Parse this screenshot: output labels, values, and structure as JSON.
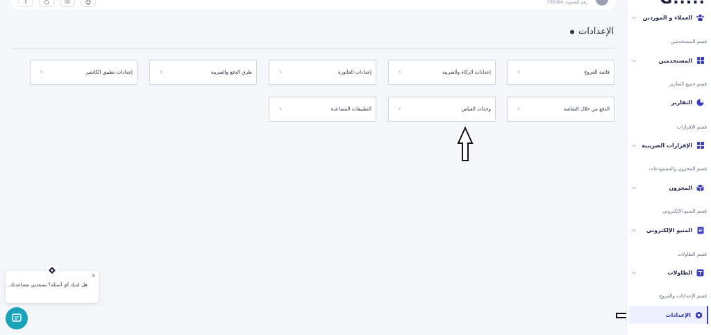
{
  "brand": "G.....",
  "topbar": {
    "registration_text": "رقم العضوية: 705064",
    "buttons": [
      "!",
      "⬡",
      "🗐",
      "☺"
    ]
  },
  "page": {
    "title": "الإعدادات"
  },
  "cards": [
    "قائمة الفروع",
    "إعدادات الزكاة والضريبة",
    "إعدادات الفاتورة",
    "طرق الدفع والضريبة",
    "إعدادات تطبيق الكاشير",
    "الدفع من خلال الشاشة",
    "وحدات القياس",
    "التطبيقات المساعدة"
  ],
  "sidebar": {
    "items": [
      {
        "label": "العملاء و الموردين",
        "icon": "users-icon"
      },
      {
        "section": "قسم المستخدمين",
        "label": "المستخدمين",
        "icon": "grid-icon"
      },
      {
        "section": "قسم جميع التقارير",
        "label": "التقارير",
        "icon": "pie-chart-icon"
      },
      {
        "section": "قسم الإقرارات",
        "label": "الإقرارات الضريبية",
        "icon": "grid-icon"
      },
      {
        "section": "قسم المخزون والمستودعات",
        "label": "المخزون",
        "icon": "box-icon"
      },
      {
        "section": "قسم المنيو الإلكتروني",
        "label": "المنيو الإلكتروني",
        "icon": "menu-doc-icon"
      },
      {
        "section": "قسم الطاولات",
        "label": "الطاولات",
        "icon": "table-icon"
      },
      {
        "section": "قسم الإعدادات والفروع",
        "label": "الإعدادات",
        "icon": "settings-icon",
        "active": true
      }
    ]
  },
  "chat": {
    "message": "هل لديك أي أسئلة؟ يسعدني مساعدتك.",
    "close": "×"
  },
  "colors": {
    "accent": "#3b3dbf",
    "chat": "#1aa3b8",
    "active_bg": "#eef0ff"
  }
}
